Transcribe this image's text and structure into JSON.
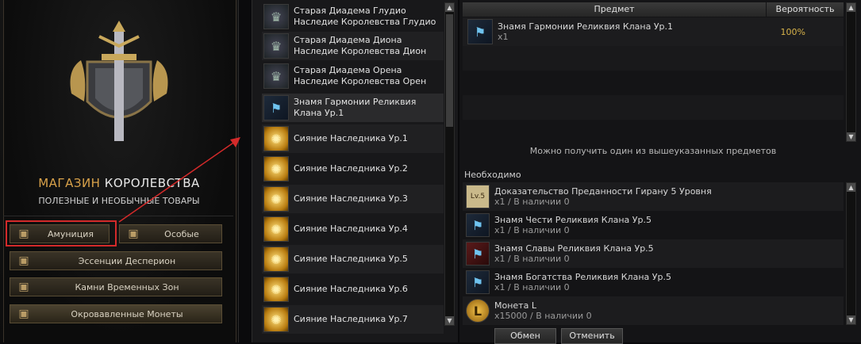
{
  "left": {
    "title_accent": "МАГАЗИН",
    "title_rest": " КОРОЛЕВСТВА",
    "subtitle": "ПОЛЕЗНЫЕ И НЕОБЫЧНЫЕ ТОВАРЫ",
    "categories": {
      "ammo": "Амуниция",
      "special": "Особые",
      "essences": "Эссенции Десперион",
      "time_stones": "Камни Временных Зон",
      "bloody_coins": "Окровавленные Монеты"
    }
  },
  "list": {
    "items": [
      {
        "label": "Старая Диадема Глудио Наследие Королевства Глудио",
        "icon": "tiara-icon"
      },
      {
        "label": "Старая Диадема Диона Наследие Королевства Дион",
        "icon": "tiara-icon"
      },
      {
        "label": "Старая Диадема Орена Наследие Королевства Орен",
        "icon": "tiara-icon"
      },
      {
        "label": "Знамя Гармонии Реликвия Клана Ур.1",
        "icon": "banner-icon",
        "selected": true
      },
      {
        "label": "Сияние Наследника Ур.1",
        "icon": "radiance-icon"
      },
      {
        "label": "Сияние Наследника Ур.2",
        "icon": "radiance-icon"
      },
      {
        "label": "Сияние Наследника Ур.3",
        "icon": "radiance-icon"
      },
      {
        "label": "Сияние Наследника Ур.4",
        "icon": "radiance-icon"
      },
      {
        "label": "Сияние Наследника Ур.5",
        "icon": "radiance-icon"
      },
      {
        "label": "Сияние Наследника Ур.6",
        "icon": "radiance-icon"
      },
      {
        "label": "Сияние Наследника Ур.7",
        "icon": "radiance-icon"
      }
    ]
  },
  "reward": {
    "col_item": "Предмет",
    "col_chance": "Вероятность",
    "name": "Знамя Гармонии Реликвия Клана Ур.1",
    "qty": "x1",
    "chance": "100%",
    "note": "Можно получить один из вышеуказанных предметов"
  },
  "required": {
    "title": "Необходимо",
    "items": [
      {
        "name": "Доказательство Преданности Гирану 5 Уровня",
        "count": "x1 / В наличии 0",
        "badge": "Lv.5"
      },
      {
        "name": "Знамя Чести Реликвия Клана Ур.5",
        "count": "x1 / В наличии 0"
      },
      {
        "name": "Знамя Славы Реликвия Клана Ур.5",
        "count": "x1 / В наличии 0"
      },
      {
        "name": "Знамя Богатства Реликвия Клана Ур.5",
        "count": "x1 / В наличии 0"
      },
      {
        "name": "Монета L",
        "count": "x15000 / В наличии 0",
        "badge": "L"
      }
    ]
  },
  "actions": {
    "exchange": "Обмен",
    "cancel": "Отменить"
  },
  "colors": {
    "accent": "#d9a24a",
    "highlight": "#d42a2a",
    "percent": "#d8b34a"
  }
}
